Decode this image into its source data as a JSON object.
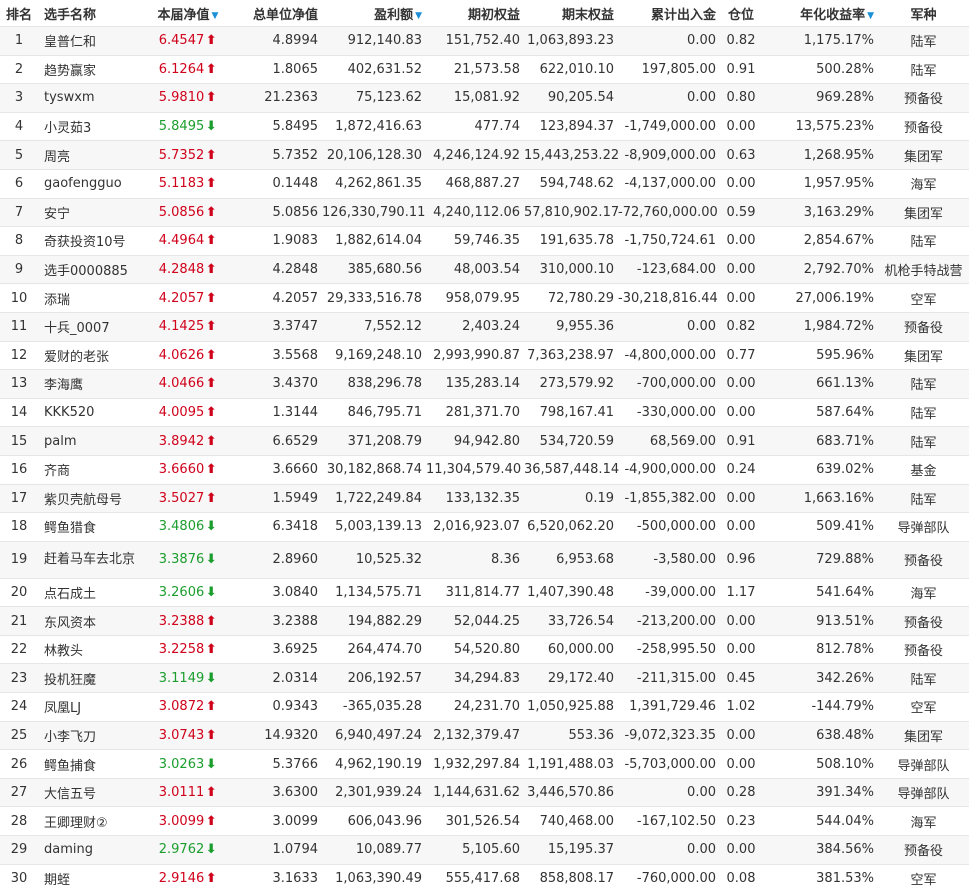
{
  "headers": {
    "rank": "排名",
    "name": "选手名称",
    "nav": "本届净值",
    "unit_nav": "总单位净值",
    "profit": "盈利额",
    "begin": "期初权益",
    "end": "期末权益",
    "flow": "累计出入金",
    "position": "仓位",
    "annual": "年化收益率",
    "branch": "军种"
  },
  "colors": {
    "up": "#d0021b",
    "down": "#1c9e2e",
    "sort_indicator": "#1a8fd8"
  },
  "rows": [
    {
      "rank": "1",
      "name": "皇普仁和",
      "nav": "6.4547",
      "trend": "up",
      "unit_nav": "4.8994",
      "profit": "912,140.83",
      "begin": "151,752.40",
      "end": "1,063,893.23",
      "flow": "0.00",
      "position": "0.82",
      "annual": "1,175.17%",
      "branch": "陆军"
    },
    {
      "rank": "2",
      "name": "趋势赢家",
      "nav": "6.1264",
      "trend": "up",
      "unit_nav": "1.8065",
      "profit": "402,631.52",
      "begin": "21,573.58",
      "end": "622,010.10",
      "flow": "197,805.00",
      "position": "0.91",
      "annual": "500.28%",
      "branch": "陆军"
    },
    {
      "rank": "3",
      "name": "tyswxm",
      "nav": "5.9810",
      "trend": "up",
      "unit_nav": "21.2363",
      "profit": "75,123.62",
      "begin": "15,081.92",
      "end": "90,205.54",
      "flow": "0.00",
      "position": "0.80",
      "annual": "969.28%",
      "branch": "预备役"
    },
    {
      "rank": "4",
      "name": "小灵茹3",
      "nav": "5.8495",
      "trend": "down",
      "unit_nav": "5.8495",
      "profit": "1,872,416.63",
      "begin": "477.74",
      "end": "123,894.37",
      "flow": "-1,749,000.00",
      "position": "0.00",
      "annual": "13,575.23%",
      "branch": "预备役"
    },
    {
      "rank": "5",
      "name": "周亮",
      "nav": "5.7352",
      "trend": "up",
      "unit_nav": "5.7352",
      "profit": "20,106,128.30",
      "begin": "4,246,124.92",
      "end": "15,443,253.22",
      "flow": "-8,909,000.00",
      "position": "0.63",
      "annual": "1,268.95%",
      "branch": "集团军"
    },
    {
      "rank": "6",
      "name": "gaofengguo",
      "nav": "5.1183",
      "trend": "up",
      "unit_nav": "0.1448",
      "profit": "4,262,861.35",
      "begin": "468,887.27",
      "end": "594,748.62",
      "flow": "-4,137,000.00",
      "position": "0.00",
      "annual": "1,957.95%",
      "branch": "海军"
    },
    {
      "rank": "7",
      "name": "安宁",
      "nav": "5.0856",
      "trend": "up",
      "unit_nav": "5.0856",
      "profit": "126,330,790.11",
      "begin": "4,240,112.06",
      "end": "57,810,902.17",
      "flow": "-72,760,000.00",
      "position": "0.59",
      "annual": "3,163.29%",
      "branch": "集团军"
    },
    {
      "rank": "8",
      "name": "奇获投资10号",
      "nav": "4.4964",
      "trend": "up",
      "unit_nav": "1.9083",
      "profit": "1,882,614.04",
      "begin": "59,746.35",
      "end": "191,635.78",
      "flow": "-1,750,724.61",
      "position": "0.00",
      "annual": "2,854.67%",
      "branch": "陆军"
    },
    {
      "rank": "9",
      "name": "选手0000885",
      "nav": "4.2848",
      "trend": "up",
      "unit_nav": "4.2848",
      "profit": "385,680.56",
      "begin": "48,003.54",
      "end": "310,000.10",
      "flow": "-123,684.00",
      "position": "0.00",
      "annual": "2,792.70%",
      "branch": "机枪手特战营"
    },
    {
      "rank": "10",
      "name": "添瑞",
      "nav": "4.2057",
      "trend": "up",
      "unit_nav": "4.2057",
      "profit": "29,333,516.78",
      "begin": "958,079.95",
      "end": "72,780.29",
      "flow": "-30,218,816.44",
      "position": "0.00",
      "annual": "27,006.19%",
      "branch": "空军"
    },
    {
      "rank": "11",
      "name": "十兵_0007",
      "nav": "4.1425",
      "trend": "up",
      "unit_nav": "3.3747",
      "profit": "7,552.12",
      "begin": "2,403.24",
      "end": "9,955.36",
      "flow": "0.00",
      "position": "0.82",
      "annual": "1,984.72%",
      "branch": "预备役"
    },
    {
      "rank": "12",
      "name": "爱财的老张",
      "nav": "4.0626",
      "trend": "up",
      "unit_nav": "3.5568",
      "profit": "9,169,248.10",
      "begin": "2,993,990.87",
      "end": "7,363,238.97",
      "flow": "-4,800,000.00",
      "position": "0.77",
      "annual": "595.96%",
      "branch": "集团军"
    },
    {
      "rank": "13",
      "name": "李海鹰",
      "nav": "4.0466",
      "trend": "up",
      "unit_nav": "3.4370",
      "profit": "838,296.78",
      "begin": "135,283.14",
      "end": "273,579.92",
      "flow": "-700,000.00",
      "position": "0.00",
      "annual": "661.13%",
      "branch": "陆军"
    },
    {
      "rank": "14",
      "name": "KKK520",
      "nav": "4.0095",
      "trend": "up",
      "unit_nav": "1.3144",
      "profit": "846,795.71",
      "begin": "281,371.70",
      "end": "798,167.41",
      "flow": "-330,000.00",
      "position": "0.00",
      "annual": "587.64%",
      "branch": "陆军"
    },
    {
      "rank": "15",
      "name": "palm",
      "nav": "3.8942",
      "trend": "up",
      "unit_nav": "6.6529",
      "profit": "371,208.79",
      "begin": "94,942.80",
      "end": "534,720.59",
      "flow": "68,569.00",
      "position": "0.91",
      "annual": "683.71%",
      "branch": "陆军"
    },
    {
      "rank": "16",
      "name": "齐商",
      "nav": "3.6660",
      "trend": "up",
      "unit_nav": "3.6660",
      "profit": "30,182,868.74",
      "begin": "11,304,579.40",
      "end": "36,587,448.14",
      "flow": "-4,900,000.00",
      "position": "0.24",
      "annual": "639.02%",
      "branch": "基金"
    },
    {
      "rank": "17",
      "name": "紫贝壳航母号",
      "nav": "3.5027",
      "trend": "up",
      "unit_nav": "1.5949",
      "profit": "1,722,249.84",
      "begin": "133,132.35",
      "end": "0.19",
      "flow": "-1,855,382.00",
      "position": "0.00",
      "annual": "1,663.16%",
      "branch": "陆军"
    },
    {
      "rank": "18",
      "name": "鳄鱼猎食",
      "nav": "3.4806",
      "trend": "down",
      "unit_nav": "6.3418",
      "profit": "5,003,139.13",
      "begin": "2,016,923.07",
      "end": "6,520,062.20",
      "flow": "-500,000.00",
      "position": "0.00",
      "annual": "509.41%",
      "branch": "导弹部队"
    },
    {
      "rank": "19",
      "name": "赶着马车去北京",
      "nav": "3.3876",
      "trend": "down",
      "unit_nav": "2.8960",
      "profit": "10,525.32",
      "begin": "8.36",
      "end": "6,953.68",
      "flow": "-3,580.00",
      "position": "0.96",
      "annual": "729.88%",
      "branch": "预备役",
      "wrap": true
    },
    {
      "rank": "20",
      "name": "点石成土",
      "nav": "3.2606",
      "trend": "down",
      "unit_nav": "3.0840",
      "profit": "1,134,575.71",
      "begin": "311,814.77",
      "end": "1,407,390.48",
      "flow": "-39,000.00",
      "position": "1.17",
      "annual": "541.64%",
      "branch": "海军"
    },
    {
      "rank": "21",
      "name": "东风资本",
      "nav": "3.2388",
      "trend": "up",
      "unit_nav": "3.2388",
      "profit": "194,882.29",
      "begin": "52,044.25",
      "end": "33,726.54",
      "flow": "-213,200.00",
      "position": "0.00",
      "annual": "913.51%",
      "branch": "预备役"
    },
    {
      "rank": "22",
      "name": "林教头",
      "nav": "3.2258",
      "trend": "up",
      "unit_nav": "3.6925",
      "profit": "264,474.70",
      "begin": "54,520.80",
      "end": "60,000.00",
      "flow": "-258,995.50",
      "position": "0.00",
      "annual": "812.78%",
      "branch": "预备役"
    },
    {
      "rank": "23",
      "name": "投机狂魔",
      "nav": "3.1149",
      "trend": "down",
      "unit_nav": "2.0314",
      "profit": "206,192.57",
      "begin": "34,294.83",
      "end": "29,172.40",
      "flow": "-211,315.00",
      "position": "0.45",
      "annual": "342.26%",
      "branch": "陆军"
    },
    {
      "rank": "24",
      "name": "凤凰LJ",
      "nav": "3.0872",
      "trend": "up",
      "unit_nav": "0.9343",
      "profit": "-365,035.28",
      "begin": "24,231.70",
      "end": "1,050,925.88",
      "flow": "1,391,729.46",
      "position": "1.02",
      "annual": "-144.79%",
      "branch": "空军"
    },
    {
      "rank": "25",
      "name": "小李飞刀",
      "nav": "3.0743",
      "trend": "up",
      "unit_nav": "14.9320",
      "profit": "6,940,497.24",
      "begin": "2,132,379.47",
      "end": "553.36",
      "flow": "-9,072,323.35",
      "position": "0.00",
      "annual": "638.48%",
      "branch": "集团军"
    },
    {
      "rank": "26",
      "name": "鳄鱼捕食",
      "nav": "3.0263",
      "trend": "down",
      "unit_nav": "5.3766",
      "profit": "4,962,190.19",
      "begin": "1,932,297.84",
      "end": "1,191,488.03",
      "flow": "-5,703,000.00",
      "position": "0.00",
      "annual": "508.10%",
      "branch": "导弹部队"
    },
    {
      "rank": "27",
      "name": "大信五号",
      "nav": "3.0111",
      "trend": "up",
      "unit_nav": "3.6300",
      "profit": "2,301,939.24",
      "begin": "1,144,631.62",
      "end": "3,446,570.86",
      "flow": "0.00",
      "position": "0.28",
      "annual": "391.34%",
      "branch": "导弹部队"
    },
    {
      "rank": "28",
      "name": "王卿理财②",
      "nav": "3.0099",
      "trend": "up",
      "unit_nav": "3.0099",
      "profit": "606,043.96",
      "begin": "301,526.54",
      "end": "740,468.00",
      "flow": "-167,102.50",
      "position": "0.23",
      "annual": "544.04%",
      "branch": "海军"
    },
    {
      "rank": "29",
      "name": "daming",
      "nav": "2.9762",
      "trend": "down",
      "unit_nav": "1.0794",
      "profit": "10,089.77",
      "begin": "5,105.60",
      "end": "15,195.37",
      "flow": "0.00",
      "position": "0.00",
      "annual": "384.56%",
      "branch": "预备役"
    },
    {
      "rank": "30",
      "name": "期蛭",
      "nav": "2.9146",
      "trend": "up",
      "unit_nav": "3.1633",
      "profit": "1,063,390.49",
      "begin": "555,417.68",
      "end": "858,808.17",
      "flow": "-760,000.00",
      "position": "0.08",
      "annual": "381.53%",
      "branch": "空军"
    }
  ]
}
